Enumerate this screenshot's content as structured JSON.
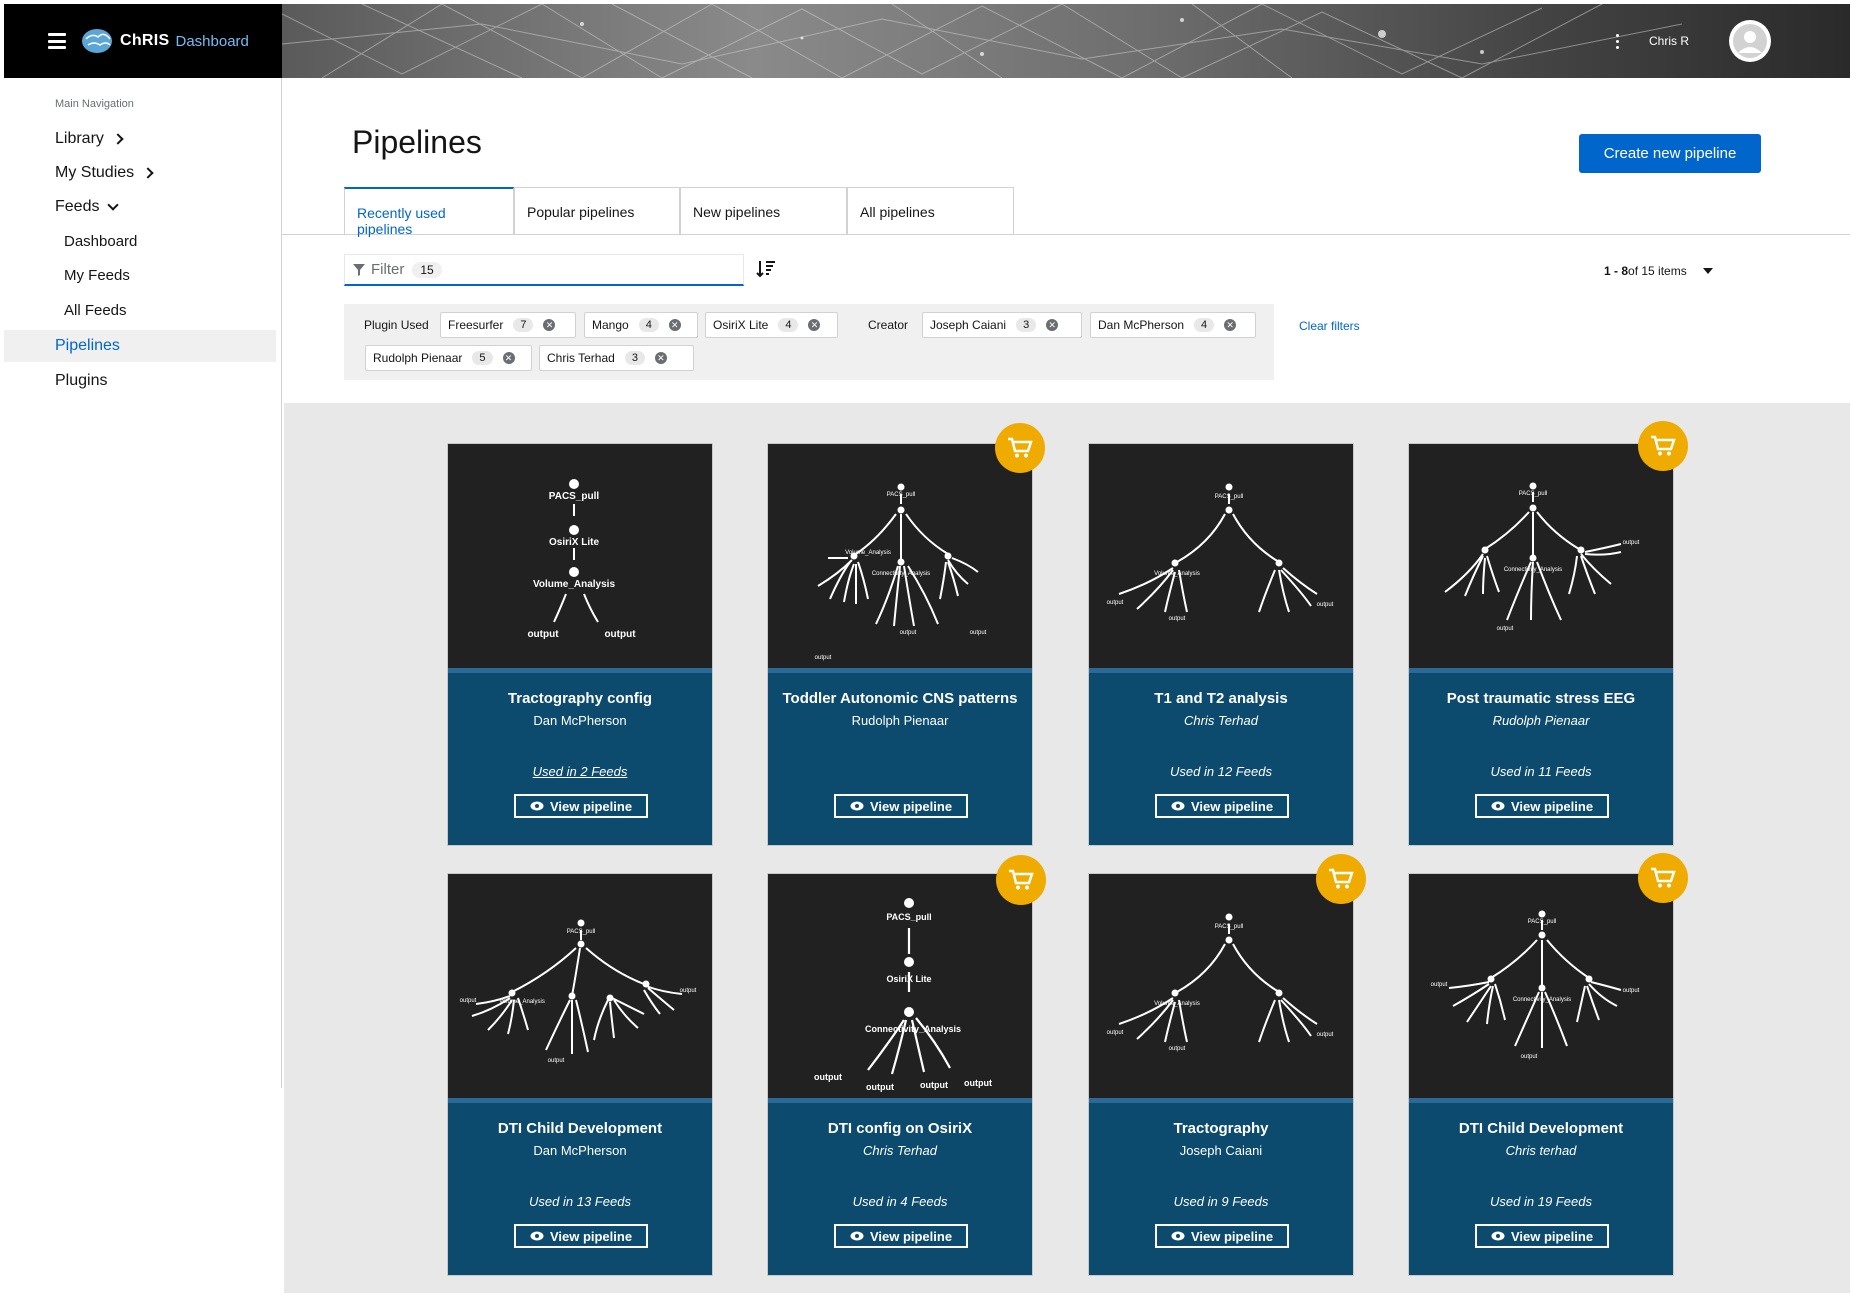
{
  "brand": {
    "name": "ChRIS",
    "suffix": "Dashboard"
  },
  "header": {
    "username": "Chris R"
  },
  "sidebar": {
    "section_title": "Main Navigation",
    "items": {
      "library": "Library",
      "my_studies": "My Studies",
      "feeds": "Feeds",
      "dashboard": "Dashboard",
      "my_feeds": "My Feeds",
      "all_feeds": "All Feeds",
      "pipelines": "Pipelines",
      "plugins": "Plugins"
    }
  },
  "main": {
    "title": "Pipelines",
    "create_button": "Create new pipeline",
    "tabs": [
      "Recently used pipelines",
      "Popular pipelines",
      "New pipelines",
      "All pipelines"
    ],
    "filter": {
      "placeholder": "Filter",
      "count": "15"
    },
    "pagination": {
      "range": "1 - 8",
      "of_text": " of 15 items"
    },
    "chips": {
      "plugin_label": "Plugin Used",
      "creator_label": "Creator",
      "plugins": [
        {
          "name": "Freesurfer",
          "count": "7"
        },
        {
          "name": "Mango",
          "count": "4"
        },
        {
          "name": "OsiriX Lite",
          "count": "4"
        }
      ],
      "creators": [
        {
          "name": "Joseph Caiani",
          "count": "3"
        },
        {
          "name": "Dan McPherson",
          "count": "4"
        },
        {
          "name": "Rudolph Pienaar",
          "count": "5"
        },
        {
          "name": "Chris Terhad",
          "count": "3"
        }
      ],
      "clear": "Clear filters"
    }
  },
  "view_label": "View pipeline",
  "graph_text": {
    "pacs": "PACS_pull",
    "osirix": "OsiriX Lite",
    "volume": "Volume_Analysis",
    "connectivity": "Connectivity_Analysis",
    "output": "output"
  },
  "cards": [
    {
      "title": "Tractography config",
      "author": "Dan McPherson",
      "used": "Used in 2 Feeds"
    },
    {
      "title": "Toddler Autonomic CNS patterns",
      "author": "Rudolph Pienaar",
      "used": ""
    },
    {
      "title": "T1 and T2 analysis",
      "author": "Chris Terhad",
      "used": "Used in 12 Feeds"
    },
    {
      "title": "Post traumatic stress EEG",
      "author": "Rudolph Pienaar",
      "used": "Used in 11 Feeds"
    },
    {
      "title": "DTI Child Development",
      "author": "Dan McPherson",
      "used": "Used in 13 Feeds"
    },
    {
      "title": "DTI  config on OsiriX",
      "author": "Chris Terhad",
      "used": "Used in 4 Feeds"
    },
    {
      "title": "Tractography",
      "author": "Joseph Caiani",
      "used": "Used in 9 Feeds"
    },
    {
      "title": "DTI Child Development",
      "author": "Chris terhad",
      "used": "Used in 19 Feeds"
    }
  ],
  "colors": {
    "accent": "#0066cc",
    "card": "#0c4a6e",
    "cart": "#f0ab00",
    "dark": "#212121"
  }
}
